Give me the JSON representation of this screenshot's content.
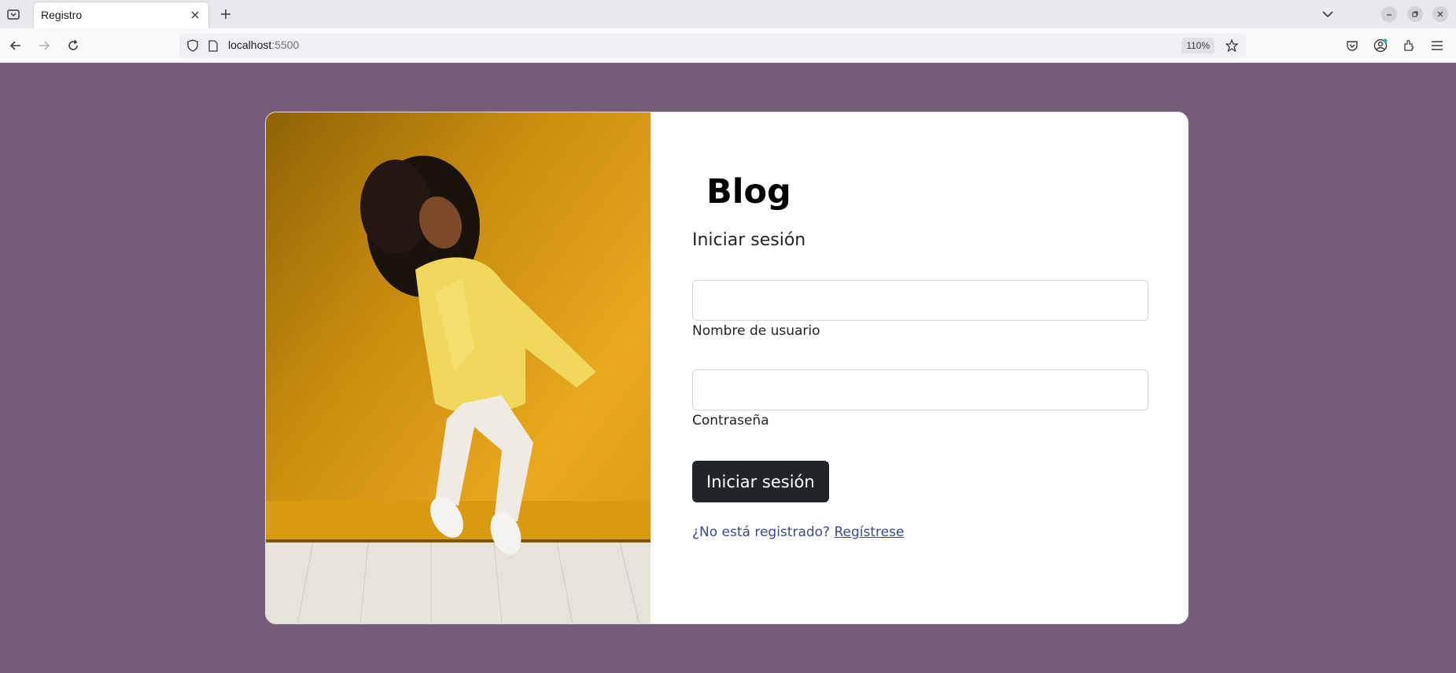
{
  "browser": {
    "tab_title": "Registro",
    "url_host": "localhost",
    "url_port": ":5500",
    "zoom": "110%"
  },
  "page": {
    "brand": "Blog",
    "heading": "Iniciar sesión",
    "username_label": "Nombre de usuario",
    "password_label": "Contraseña",
    "submit_label": "Iniciar sesión",
    "register_prompt": "¿No está registrado?",
    "register_link": "Regístrese"
  },
  "colors": {
    "page_bg": "#765c7b",
    "card_bg": "#ffffff",
    "button_bg": "#212529",
    "link": "#3a4a8a",
    "photo_bg": "#e7a51c"
  },
  "icons": {
    "tab_list": "tab-list-icon",
    "close": "close-icon",
    "new_tab": "plus-icon",
    "back": "back-arrow-icon",
    "forward": "forward-arrow-icon",
    "reload": "reload-icon",
    "shield": "shield-icon",
    "page": "page-icon",
    "bookmark": "star-icon",
    "pocket": "pocket-icon",
    "account": "account-icon",
    "extensions": "extensions-icon",
    "menu": "hamburger-menu-icon"
  }
}
